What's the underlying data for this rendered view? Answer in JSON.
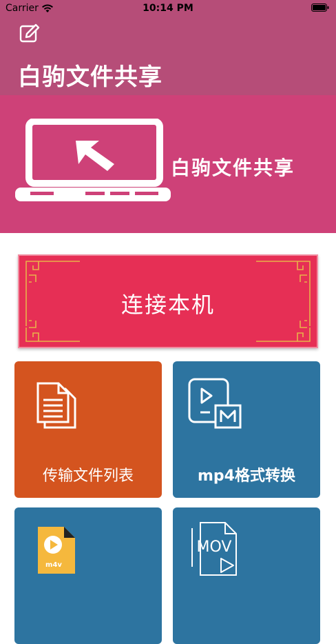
{
  "status_bar": {
    "carrier": "Carrier",
    "time": "10:14 PM"
  },
  "header": {
    "title": "白驹文件共享",
    "edit_icon": "edit-icon",
    "background_color": "#b64d78"
  },
  "banner": {
    "text": "白驹文件共享",
    "background_color": "#ce4178",
    "icon": "laptop-cursor-icon"
  },
  "connect_button": {
    "label": "连接本机",
    "background_color": "#e62f55",
    "frame_color": "#e8b24a"
  },
  "tiles": [
    {
      "label": "传输文件列表",
      "icon": "document-list-icon",
      "color": "#d4541f"
    },
    {
      "label": "mp4格式转换",
      "icon": "video-convert-icon",
      "color": "#2d74a0"
    },
    {
      "label": "",
      "icon": "m4v-file-icon",
      "color": "#2d74a0"
    },
    {
      "label": "",
      "icon": "mov-file-icon",
      "color": "#2d74a0"
    }
  ],
  "m4v_file_text": "m4v",
  "mov_file_text": "MOV"
}
